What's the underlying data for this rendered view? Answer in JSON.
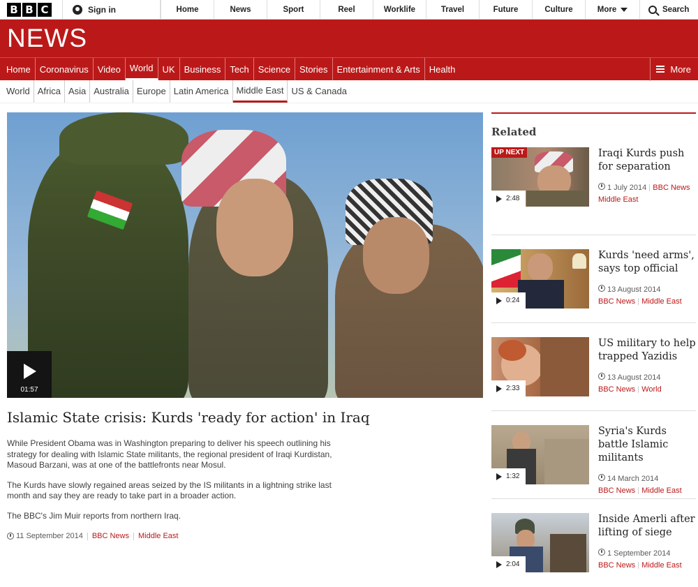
{
  "brand": {
    "letters": [
      "B",
      "B",
      "C"
    ],
    "section_title": "NEWS"
  },
  "topbar": {
    "signin": "Sign in",
    "items": [
      "Home",
      "News",
      "Sport",
      "Reel",
      "Worklife",
      "Travel",
      "Future",
      "Culture"
    ],
    "more": "More",
    "search": "Search"
  },
  "rednav": {
    "items": [
      "Home",
      "Coronavirus",
      "Video",
      "World",
      "UK",
      "Business",
      "Tech",
      "Science",
      "Stories",
      "Entertainment & Arts",
      "Health"
    ],
    "active": "World",
    "more": "More"
  },
  "subnav": {
    "items": [
      "World",
      "Africa",
      "Asia",
      "Australia",
      "Europe",
      "Latin America",
      "Middle East",
      "US & Canada"
    ],
    "active": "Middle East"
  },
  "main": {
    "video_duration": "01:57",
    "headline": "Islamic State crisis: Kurds 'ready for action' in Iraq",
    "paragraphs": [
      "While President Obama was in Washington preparing to deliver his speech outlining his strategy for dealing with Islamic State militants, the regional president of Iraqi Kurdistan, Masoud Barzani, was at one of the battlefronts near Mosul.",
      "The Kurds have slowly regained areas seized by the IS militants in a lightning strike last month and say they are ready to take part in a broader action.",
      "The BBC's Jim Muir reports from northern Iraq."
    ],
    "date": "11 September 2014",
    "tags": [
      "BBC News",
      "Middle East"
    ]
  },
  "related": {
    "heading": "Related",
    "up_next_label": "UP NEXT",
    "items": [
      {
        "title": "Iraqi Kurds push for separation",
        "duration": "2:48",
        "date": "1 July 2014",
        "tags": [
          "BBC News",
          "Middle East"
        ]
      },
      {
        "title": "Kurds 'need arms', says top official",
        "duration": "0:24",
        "date": "13 August 2014",
        "tags": [
          "BBC News",
          "Middle East"
        ]
      },
      {
        "title": "US military to help trapped Yazidis",
        "duration": "2:33",
        "date": "13 August 2014",
        "tags": [
          "BBC News",
          "World"
        ]
      },
      {
        "title": "Syria's Kurds battle Islamic militants",
        "duration": "1:32",
        "date": "14 March 2014",
        "tags": [
          "BBC News",
          "Middle East"
        ]
      },
      {
        "title": "Inside Amerli after lifting of siege",
        "duration": "2:04",
        "date": "1 September 2014",
        "tags": [
          "BBC News",
          "Middle East"
        ]
      }
    ]
  }
}
